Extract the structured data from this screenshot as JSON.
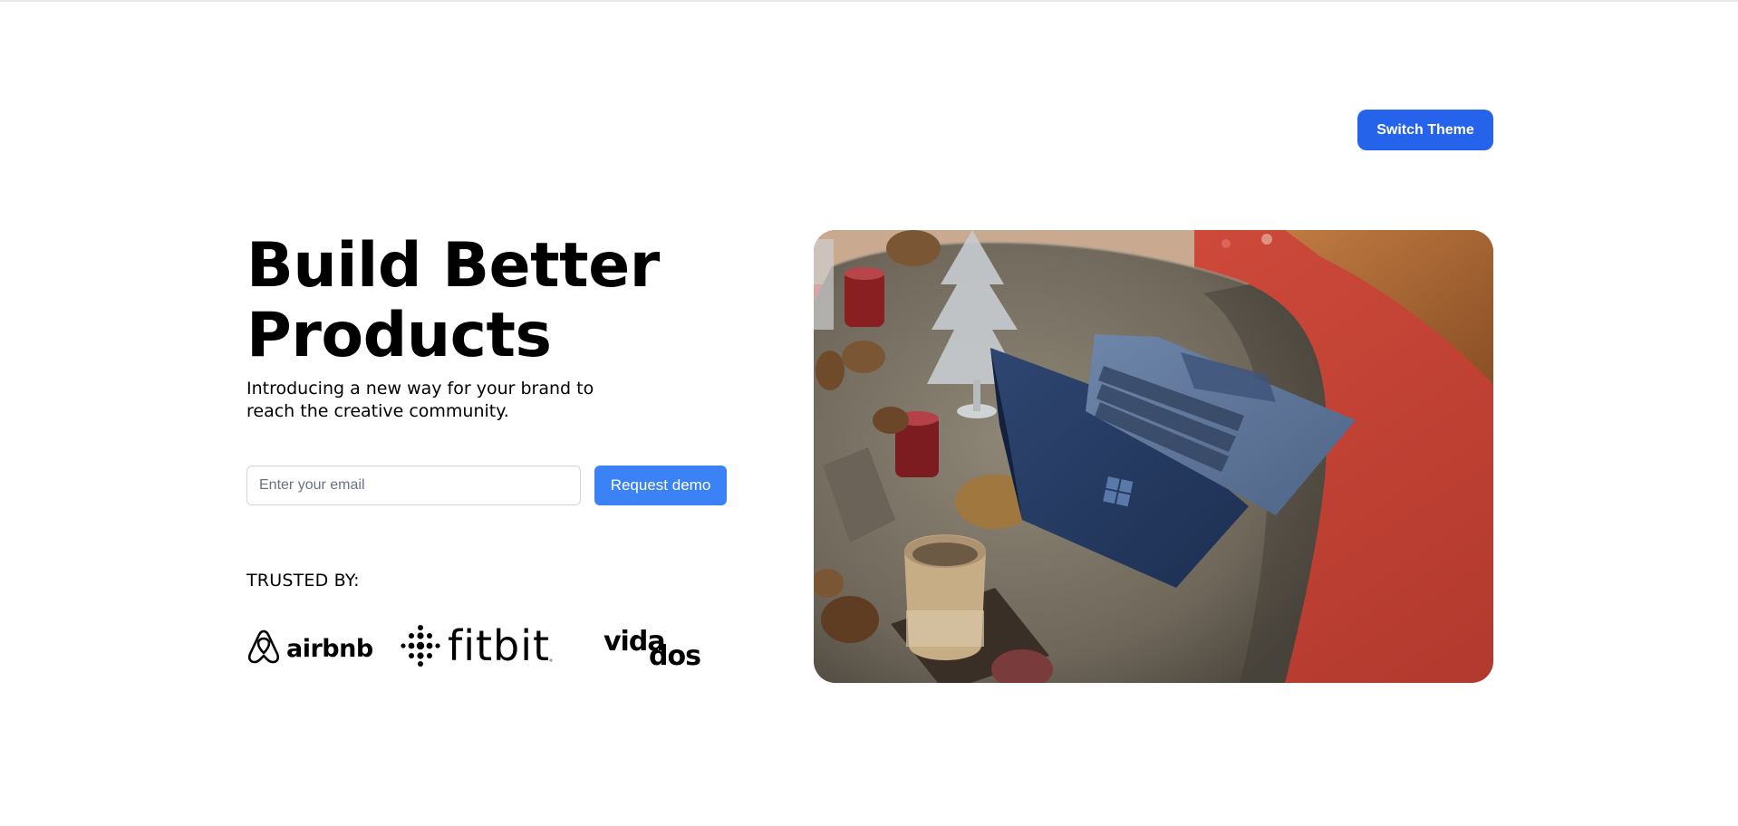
{
  "page": {
    "theme_button_label": "Switch Theme",
    "accent": "#2563eb"
  },
  "hero": {
    "headline": "Build Better\nProducts",
    "subline": "Introducing a new way for your brand to reach the creative community.",
    "email_placeholder": "Enter your email",
    "cta_label": "Request demo",
    "cta_color": "#3b82f6",
    "image_icon": "laptop-photo"
  },
  "trusted": {
    "label": "TRUSTED BY:",
    "logos": [
      {
        "name": "airbnb",
        "text": "airbnb",
        "icon": "airbnb-logo"
      },
      {
        "name": "fitbit",
        "text": "fitbit",
        "icon": "fitbit-logo"
      },
      {
        "name": "vidados",
        "text": "vidados",
        "icon": "vidados-logo"
      }
    ]
  }
}
